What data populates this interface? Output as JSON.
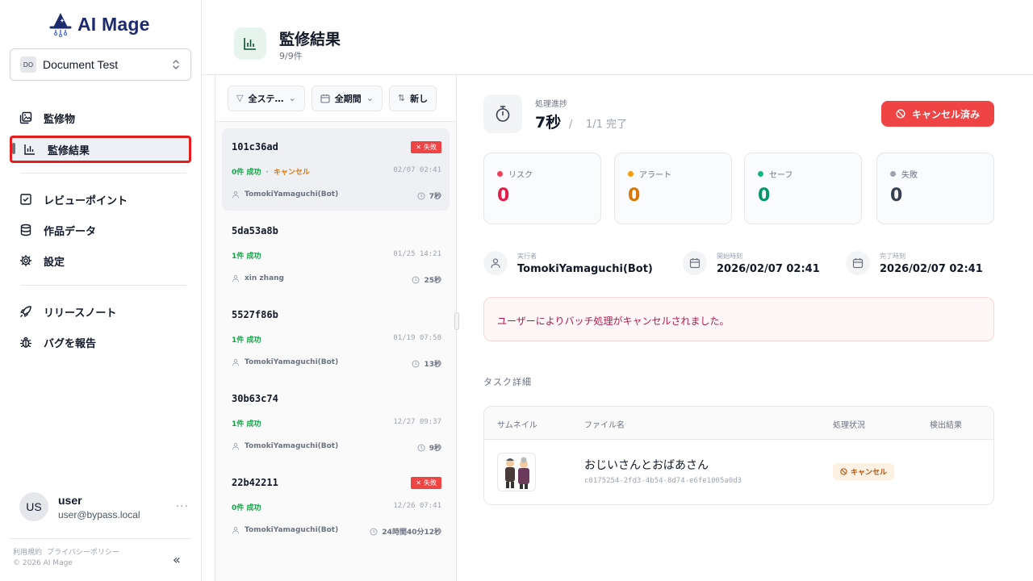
{
  "app": {
    "name": "AI Mage",
    "workspace": {
      "badge": "DO",
      "name": "Document Test"
    }
  },
  "sidebar": {
    "nav_primary": [
      {
        "label": "監修物",
        "icon": "images-icon"
      },
      {
        "label": "監修結果",
        "icon": "chart-icon",
        "active": true
      }
    ],
    "nav_secondary": [
      {
        "label": "レビューポイント",
        "icon": "checklist-icon"
      },
      {
        "label": "作品データ",
        "icon": "database-icon"
      },
      {
        "label": "設定",
        "icon": "gear-icon"
      }
    ],
    "nav_tertiary": [
      {
        "label": "リリースノート",
        "icon": "rocket-icon"
      },
      {
        "label": "バグを報告",
        "icon": "bug-icon"
      }
    ],
    "user": {
      "initials": "US",
      "name": "user",
      "email": "user@bypass.local"
    },
    "footer": {
      "terms": "利用規約",
      "privacy": "プライバシーポリシー",
      "copyright": "© 2026 AI Mage"
    }
  },
  "header": {
    "title": "監修結果",
    "count": "9/9件"
  },
  "filters": [
    {
      "label": "全ステ…",
      "icon": "filter-icon"
    },
    {
      "label": "全期間",
      "icon": "calendar-icon"
    },
    {
      "label": "新し",
      "icon": "sort-icon"
    }
  ],
  "results": [
    {
      "id": "101c36ad",
      "badge": "失敗",
      "success": "0件 成功",
      "cancel": "キャンセル",
      "date": "02/07 02:41",
      "user": "TomokiYamaguchi(Bot)",
      "duration": "7秒",
      "selected": true
    },
    {
      "id": "5da53a8b",
      "badge": "",
      "success": "1件 成功",
      "cancel": "",
      "date": "01/25 14:21",
      "user": "xin zhang",
      "duration": "25秒"
    },
    {
      "id": "5527f86b",
      "badge": "",
      "success": "1件 成功",
      "cancel": "",
      "date": "01/19 07:58",
      "user": "TomokiYamaguchi(Bot)",
      "duration": "13秒"
    },
    {
      "id": "30b63c74",
      "badge": "",
      "success": "1件 成功",
      "cancel": "",
      "date": "12/27 09:37",
      "user": "TomokiYamaguchi(Bot)",
      "duration": "9秒"
    },
    {
      "id": "22b42211",
      "badge": "失敗",
      "success": "0件 成功",
      "cancel": "",
      "date": "12/26 07:41",
      "user": "TomokiYamaguchi(Bot)",
      "duration": "24時間40分12秒"
    }
  ],
  "detail": {
    "progress_label": "処理進捗",
    "progress_time": "7秒",
    "progress_sep": "/",
    "progress_count": "1/1 完了",
    "cancelled_button": "キャンセル済み",
    "stats": [
      {
        "label": "リスク",
        "value": "0",
        "color": "#e11d48"
      },
      {
        "label": "アラート",
        "value": "0",
        "color": "#d97706"
      },
      {
        "label": "セーフ",
        "value": "0",
        "color": "#059669"
      },
      {
        "label": "失敗",
        "value": "0",
        "color": "#374151"
      }
    ],
    "meta": [
      {
        "label": "実行者",
        "value": "TomokiYamaguchi(Bot)",
        "icon": "user-icon"
      },
      {
        "label": "開始時刻",
        "value": "2026/02/07 02:41",
        "icon": "calendar-icon"
      },
      {
        "label": "完了時刻",
        "value": "2026/02/07 02:41",
        "icon": "calendar-icon"
      }
    ],
    "alert": "ユーザーによりバッチ処理がキャンセルされました。",
    "tasks_title": "タスク詳細",
    "table": {
      "headers": [
        "サムネイル",
        "ファイル名",
        "処理状況",
        "検出結果"
      ],
      "rows": [
        {
          "file_name": "おじいさんとおばあさん",
          "file_id": "c0175254-2fd3-4b54-8d74-e6fe1005a0d3",
          "status": "キャンセル",
          "result": ""
        }
      ]
    }
  }
}
